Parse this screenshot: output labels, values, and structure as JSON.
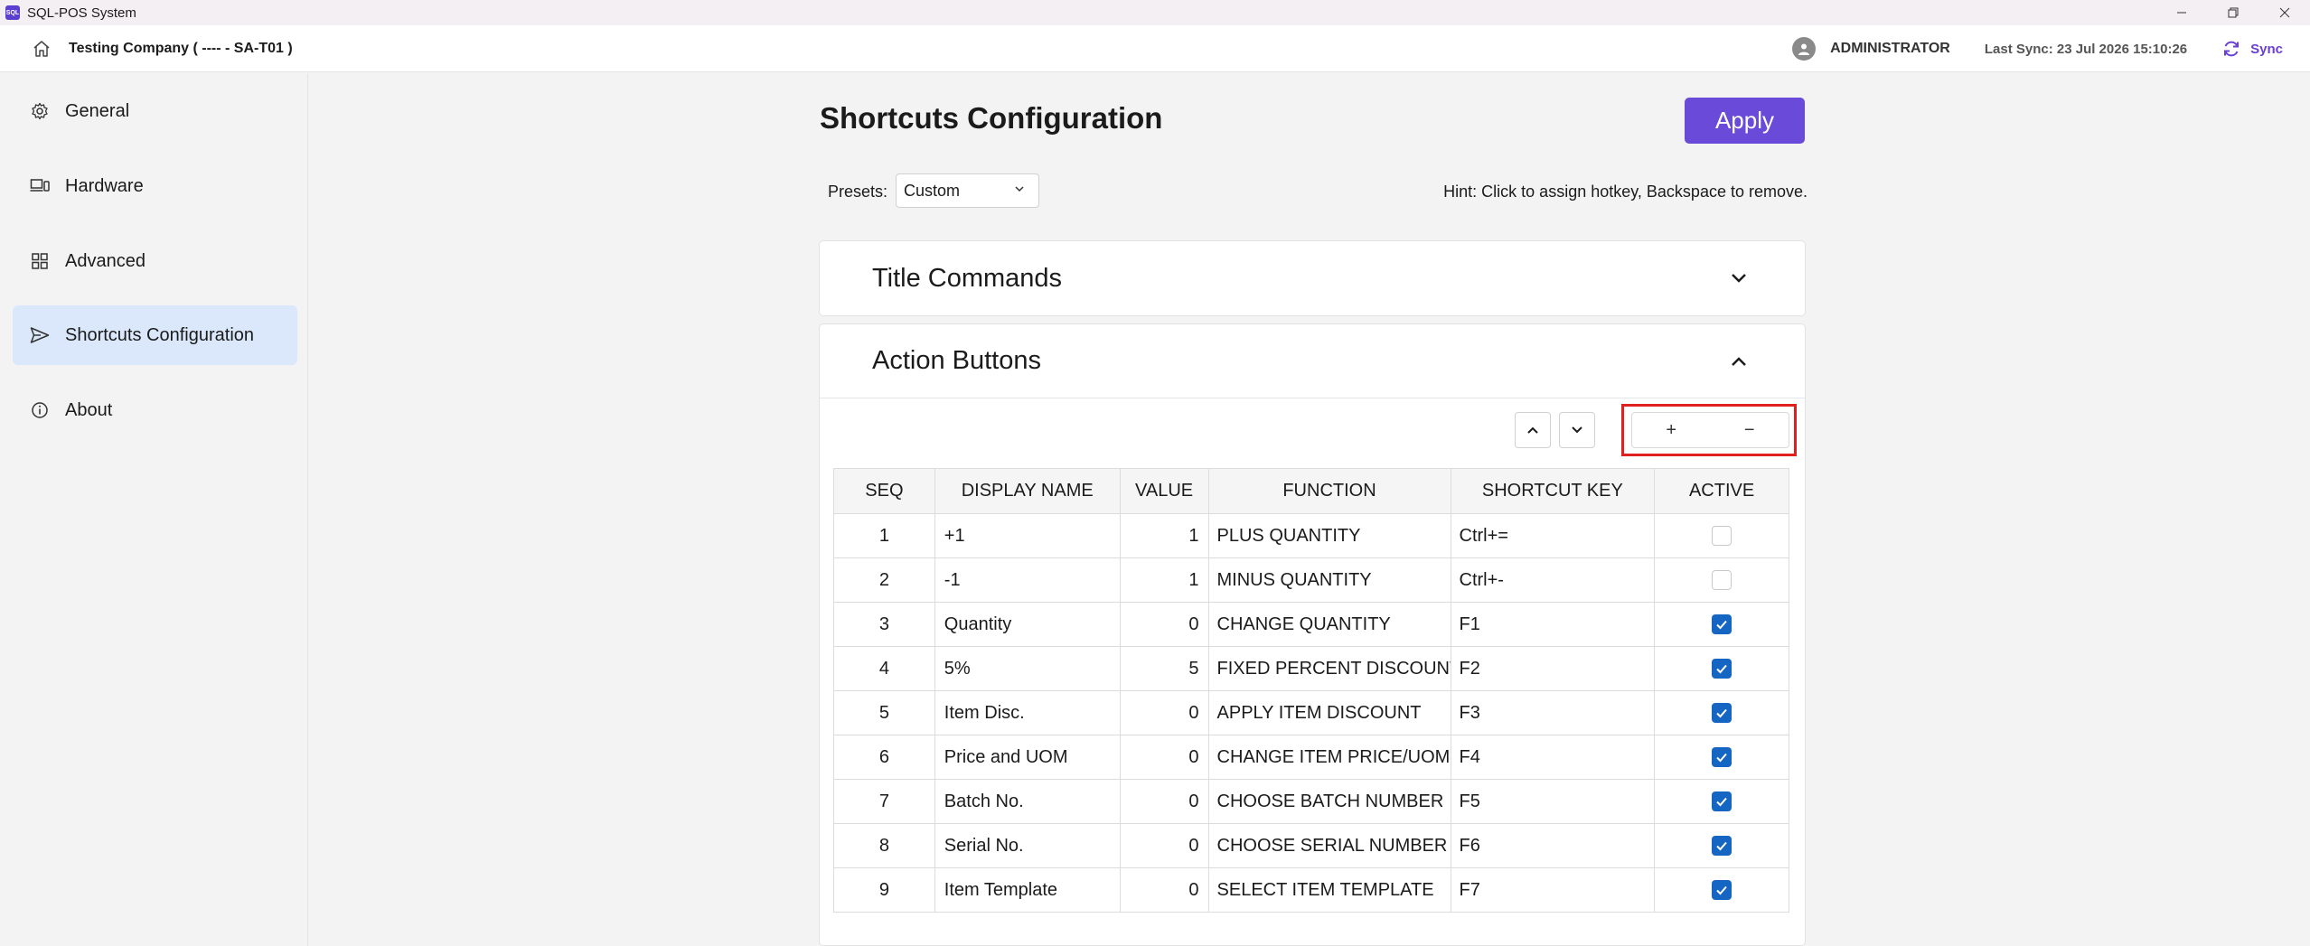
{
  "window": {
    "title": "SQL-POS System",
    "logo_text": "SQL"
  },
  "header": {
    "company": "Testing Company ( ---- - SA-T01 )",
    "user": "ADMINISTRATOR",
    "last_sync": "Last Sync: 23 Jul 2026 15:10:26",
    "sync_label": "Sync"
  },
  "sidebar": {
    "items": [
      {
        "label": "General",
        "icon": "gear-icon"
      },
      {
        "label": "Hardware",
        "icon": "devices-icon"
      },
      {
        "label": "Advanced",
        "icon": "grid-icon"
      },
      {
        "label": "Shortcuts Configuration",
        "icon": "send-icon",
        "active": true
      },
      {
        "label": "About",
        "icon": "info-icon"
      }
    ]
  },
  "main": {
    "title": "Shortcuts Configuration",
    "apply_label": "Apply",
    "presets_label": "Presets:",
    "presets_value": "Custom",
    "hint": "Hint: Click to assign hotkey, Backspace to remove.",
    "sections": [
      {
        "title": "Title Commands",
        "expanded": false
      },
      {
        "title": "Action Buttons",
        "expanded": true
      }
    ],
    "plus_label": "+",
    "minus_label": "−"
  },
  "table": {
    "columns": [
      "SEQ",
      "DISPLAY NAME",
      "VALUE",
      "FUNCTION",
      "SHORTCUT KEY",
      "ACTIVE"
    ],
    "rows": [
      {
        "seq": "1",
        "name": "+1",
        "value": "1",
        "function": "PLUS QUANTITY",
        "key": "Ctrl+=",
        "active": false
      },
      {
        "seq": "2",
        "name": "-1",
        "value": "1",
        "function": "MINUS QUANTITY",
        "key": "Ctrl+-",
        "active": false
      },
      {
        "seq": "3",
        "name": "Quantity",
        "value": "0",
        "function": "CHANGE QUANTITY",
        "key": "F1",
        "active": true
      },
      {
        "seq": "4",
        "name": "5%",
        "value": "5",
        "function": "FIXED PERCENT DISCOUNT",
        "key": "F2",
        "active": true
      },
      {
        "seq": "5",
        "name": "Item Disc.",
        "value": "0",
        "function": "APPLY ITEM DISCOUNT",
        "key": "F3",
        "active": true
      },
      {
        "seq": "6",
        "name": "Price and UOM",
        "value": "0",
        "function": "CHANGE ITEM PRICE/UOM",
        "key": "F4",
        "active": true
      },
      {
        "seq": "7",
        "name": "Batch No.",
        "value": "0",
        "function": "CHOOSE BATCH NUMBER",
        "key": "F5",
        "active": true
      },
      {
        "seq": "8",
        "name": "Serial No.",
        "value": "0",
        "function": "CHOOSE SERIAL NUMBER",
        "key": "F6",
        "active": true
      },
      {
        "seq": "9",
        "name": "Item Template",
        "value": "0",
        "function": "SELECT ITEM TEMPLATE",
        "key": "F7",
        "active": true
      }
    ]
  },
  "colors": {
    "accent": "#6a4ad8",
    "nav_active_bg": "#dbe8fb",
    "checkbox_on": "#1466c2",
    "highlight_frame": "#e0201e"
  }
}
